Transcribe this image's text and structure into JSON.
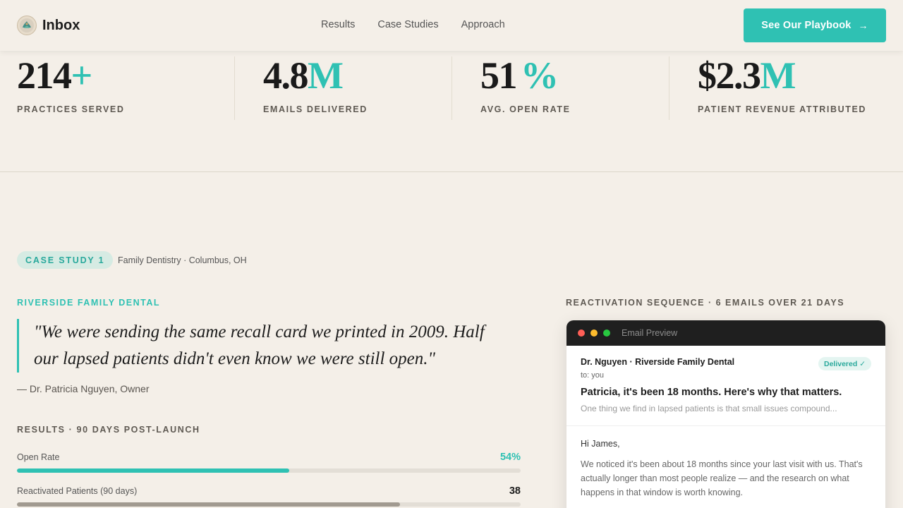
{
  "header": {
    "brand": "Inbox",
    "nav": [
      "Results",
      "Case Studies",
      "Approach"
    ],
    "cta_label": "See Our Playbook",
    "cta_icon": "arrow-right-icon"
  },
  "stats": [
    {
      "value": "214",
      "accent": "+",
      "label": "PRACTICES SERVED"
    },
    {
      "value": "4.8",
      "accent": "M",
      "label": "EMAILS DELIVERED"
    },
    {
      "value": "51",
      "accent": "%",
      "label": "AVG. OPEN RATE"
    },
    {
      "value": "$2.3",
      "accent": "M",
      "label": "PATIENT REVENUE ATTRIBUTED"
    }
  ],
  "case_study": {
    "pill": "CASE STUDY 1",
    "meta": "Family Dentistry · Columbus, OH",
    "client": "RIVERSIDE FAMILY DENTAL",
    "quote": "\"We were sending the same recall card we printed in 2009. Half our lapsed patients didn't even know we were still open.\"",
    "attribution": "— Dr. Patricia Nguyen, Owner",
    "results_title": "RESULTS · 90 DAYS POST-LAUNCH",
    "metrics": [
      {
        "label": "Open Rate",
        "value": "54%",
        "progress": 0.54,
        "color": "#2fc1b3"
      },
      {
        "label": "Reactivated Patients (90 days)",
        "value": "38",
        "progress": 0.76,
        "color": "#a19a90"
      }
    ]
  },
  "sequence": {
    "title": "REACTIVATION SEQUENCE · 6 EMAILS OVER 21 DAYS",
    "window_label": "Email Preview",
    "sender": "Dr. Nguyen · Riverside Family Dental",
    "to": "to: you",
    "badge": "Delivered ✓",
    "subject": "Patricia, it's been 18 months. Here's why that matters.",
    "preview": "One thing we find in lapsed patients is that small issues compound...",
    "greeting": "Hi James,",
    "body": "We noticed it's been about 18 months since your last visit with us. That's actually longer than most people realize — and the research on what happens in that window is worth knowing."
  },
  "colors": {
    "accent": "#2fc1b3",
    "background": "#f4efe8",
    "window_dots": [
      "#ff5f57",
      "#febc2e",
      "#28c840"
    ]
  }
}
